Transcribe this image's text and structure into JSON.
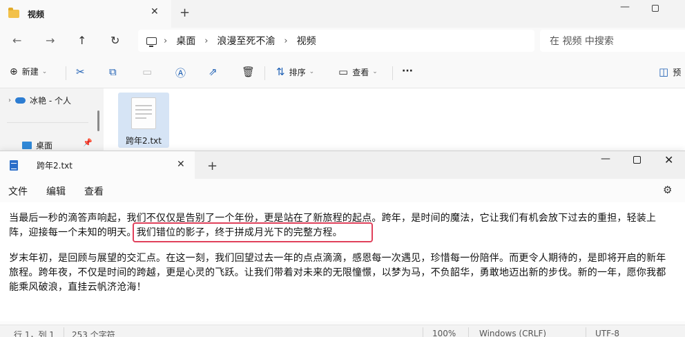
{
  "explorer": {
    "tab_title": "视频",
    "breadcrumb": [
      "桌面",
      "浪漫至死不渝",
      "视频"
    ],
    "search_placeholder": "在 视频 中搜索",
    "toolbar": {
      "new_label": "新建",
      "sort_label": "排序",
      "view_label": "查看",
      "more_label": "···",
      "preview_label": "预"
    },
    "sidebar": {
      "onedrive_label": "冰艳 - 个人",
      "desktop_label": "桌面"
    },
    "file": {
      "name": "跨年2.txt"
    }
  },
  "notepad": {
    "tab_title": "跨年2.txt",
    "menu": [
      "文件",
      "编辑",
      "查看"
    ],
    "text": {
      "p1_line1": "当最后一秒的滴答声响起，我们不仅仅是告别了一个年份，更是站在了新旅程的起点。跨年，是时间的魔法，它让我们有机会放下过去的重担，轻装上",
      "p1_line2_a": "阵，迎接每一个未知的明天。",
      "p1_line2_b": "我们错位的影子，终于拼成月光下的完整方程。",
      "p2_line1": "岁末年初，是回顾与展望的交汇点。在这一刻，我们回望过去一年的点点滴滴，感恩每一次遇见，珍惜每一份陪伴。而更令人期待的，是即将开启的新年",
      "p2_line2": "旅程。跨年夜，不仅是时间的跨越，更是心灵的飞跃。让我们带着对未来的无限憧憬，以梦为马，不负韶华，勇敢地迈出新的步伐。新的一年，愿你我都",
      "p2_line3": "能乘风破浪，直挂云帆济沧海！"
    },
    "status": {
      "position": "行 1，列 1",
      "chars": "253 个字符",
      "zoom": "100%",
      "line_ending": "Windows (CRLF)",
      "encoding": "UTF-8"
    }
  }
}
